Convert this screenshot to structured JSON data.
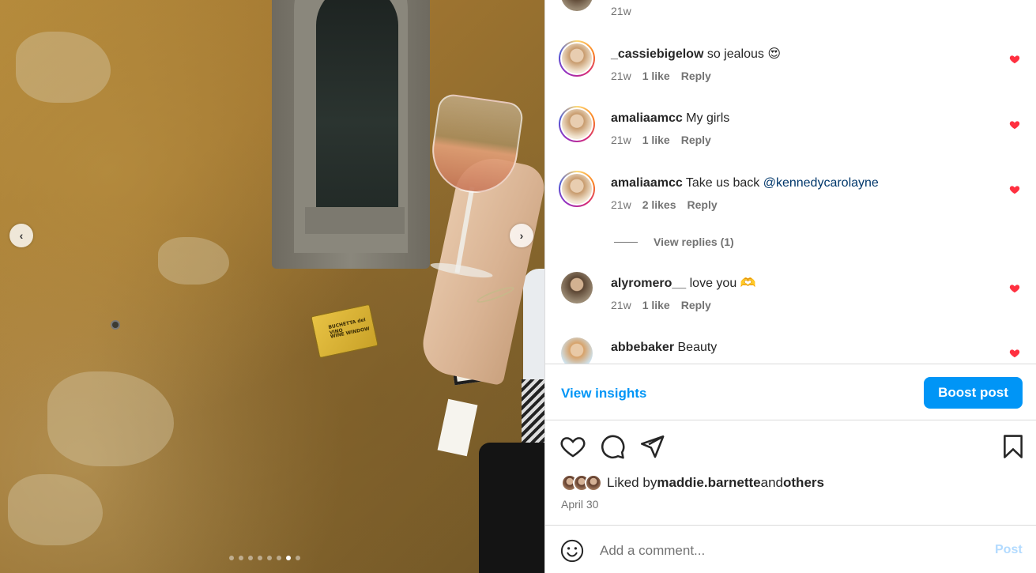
{
  "photo": {
    "plaque_lines": [
      "BUCHETTA del VINO",
      "WINE WINDOW"
    ],
    "prev_arrow": "‹",
    "next_arrow": "›",
    "dots_total": 8,
    "dots_active_index": 6
  },
  "comments": [
    {
      "username": "",
      "text": "",
      "time": "21w",
      "likes": "",
      "reply": "",
      "liked": false
    },
    {
      "username": "_cassiebigelow",
      "text": " so jealous 😍",
      "time": "21w",
      "likes": "1 like",
      "reply": "Reply",
      "liked": true
    },
    {
      "username": "amaliaamcc",
      "text": " My girls",
      "time": "21w",
      "likes": "1 like",
      "reply": "Reply",
      "liked": true
    },
    {
      "username": "amaliaamcc",
      "text": " Take us back ",
      "mention": "@kennedycarolayne",
      "time": "21w",
      "likes": "2 likes",
      "reply": "Reply",
      "liked": true
    },
    {
      "username": "alyromero__",
      "text": " love you 🫶",
      "time": "21w",
      "likes": "1 like",
      "reply": "Reply",
      "liked": true
    },
    {
      "username": "abbebaker",
      "text": " Beauty",
      "time": "",
      "likes": "",
      "reply": "",
      "liked": true
    }
  ],
  "view_replies": "View replies (1)",
  "insights": {
    "view_label": "View insights",
    "boost_label": "Boost post"
  },
  "actions": {
    "like_icon": "heart-icon",
    "comment_icon": "comment-icon",
    "share_icon": "share-icon",
    "save_icon": "bookmark-icon"
  },
  "likes": {
    "prefix": "Liked by ",
    "user": "maddie.barnette",
    "middle": " and ",
    "others": "others"
  },
  "post_date": "April 30",
  "add_comment": {
    "placeholder": "Add a comment...",
    "post_label": "Post"
  },
  "colors": {
    "accent": "#0095f6",
    "heart": "#ff3040",
    "text": "#262626",
    "muted": "#737373"
  }
}
